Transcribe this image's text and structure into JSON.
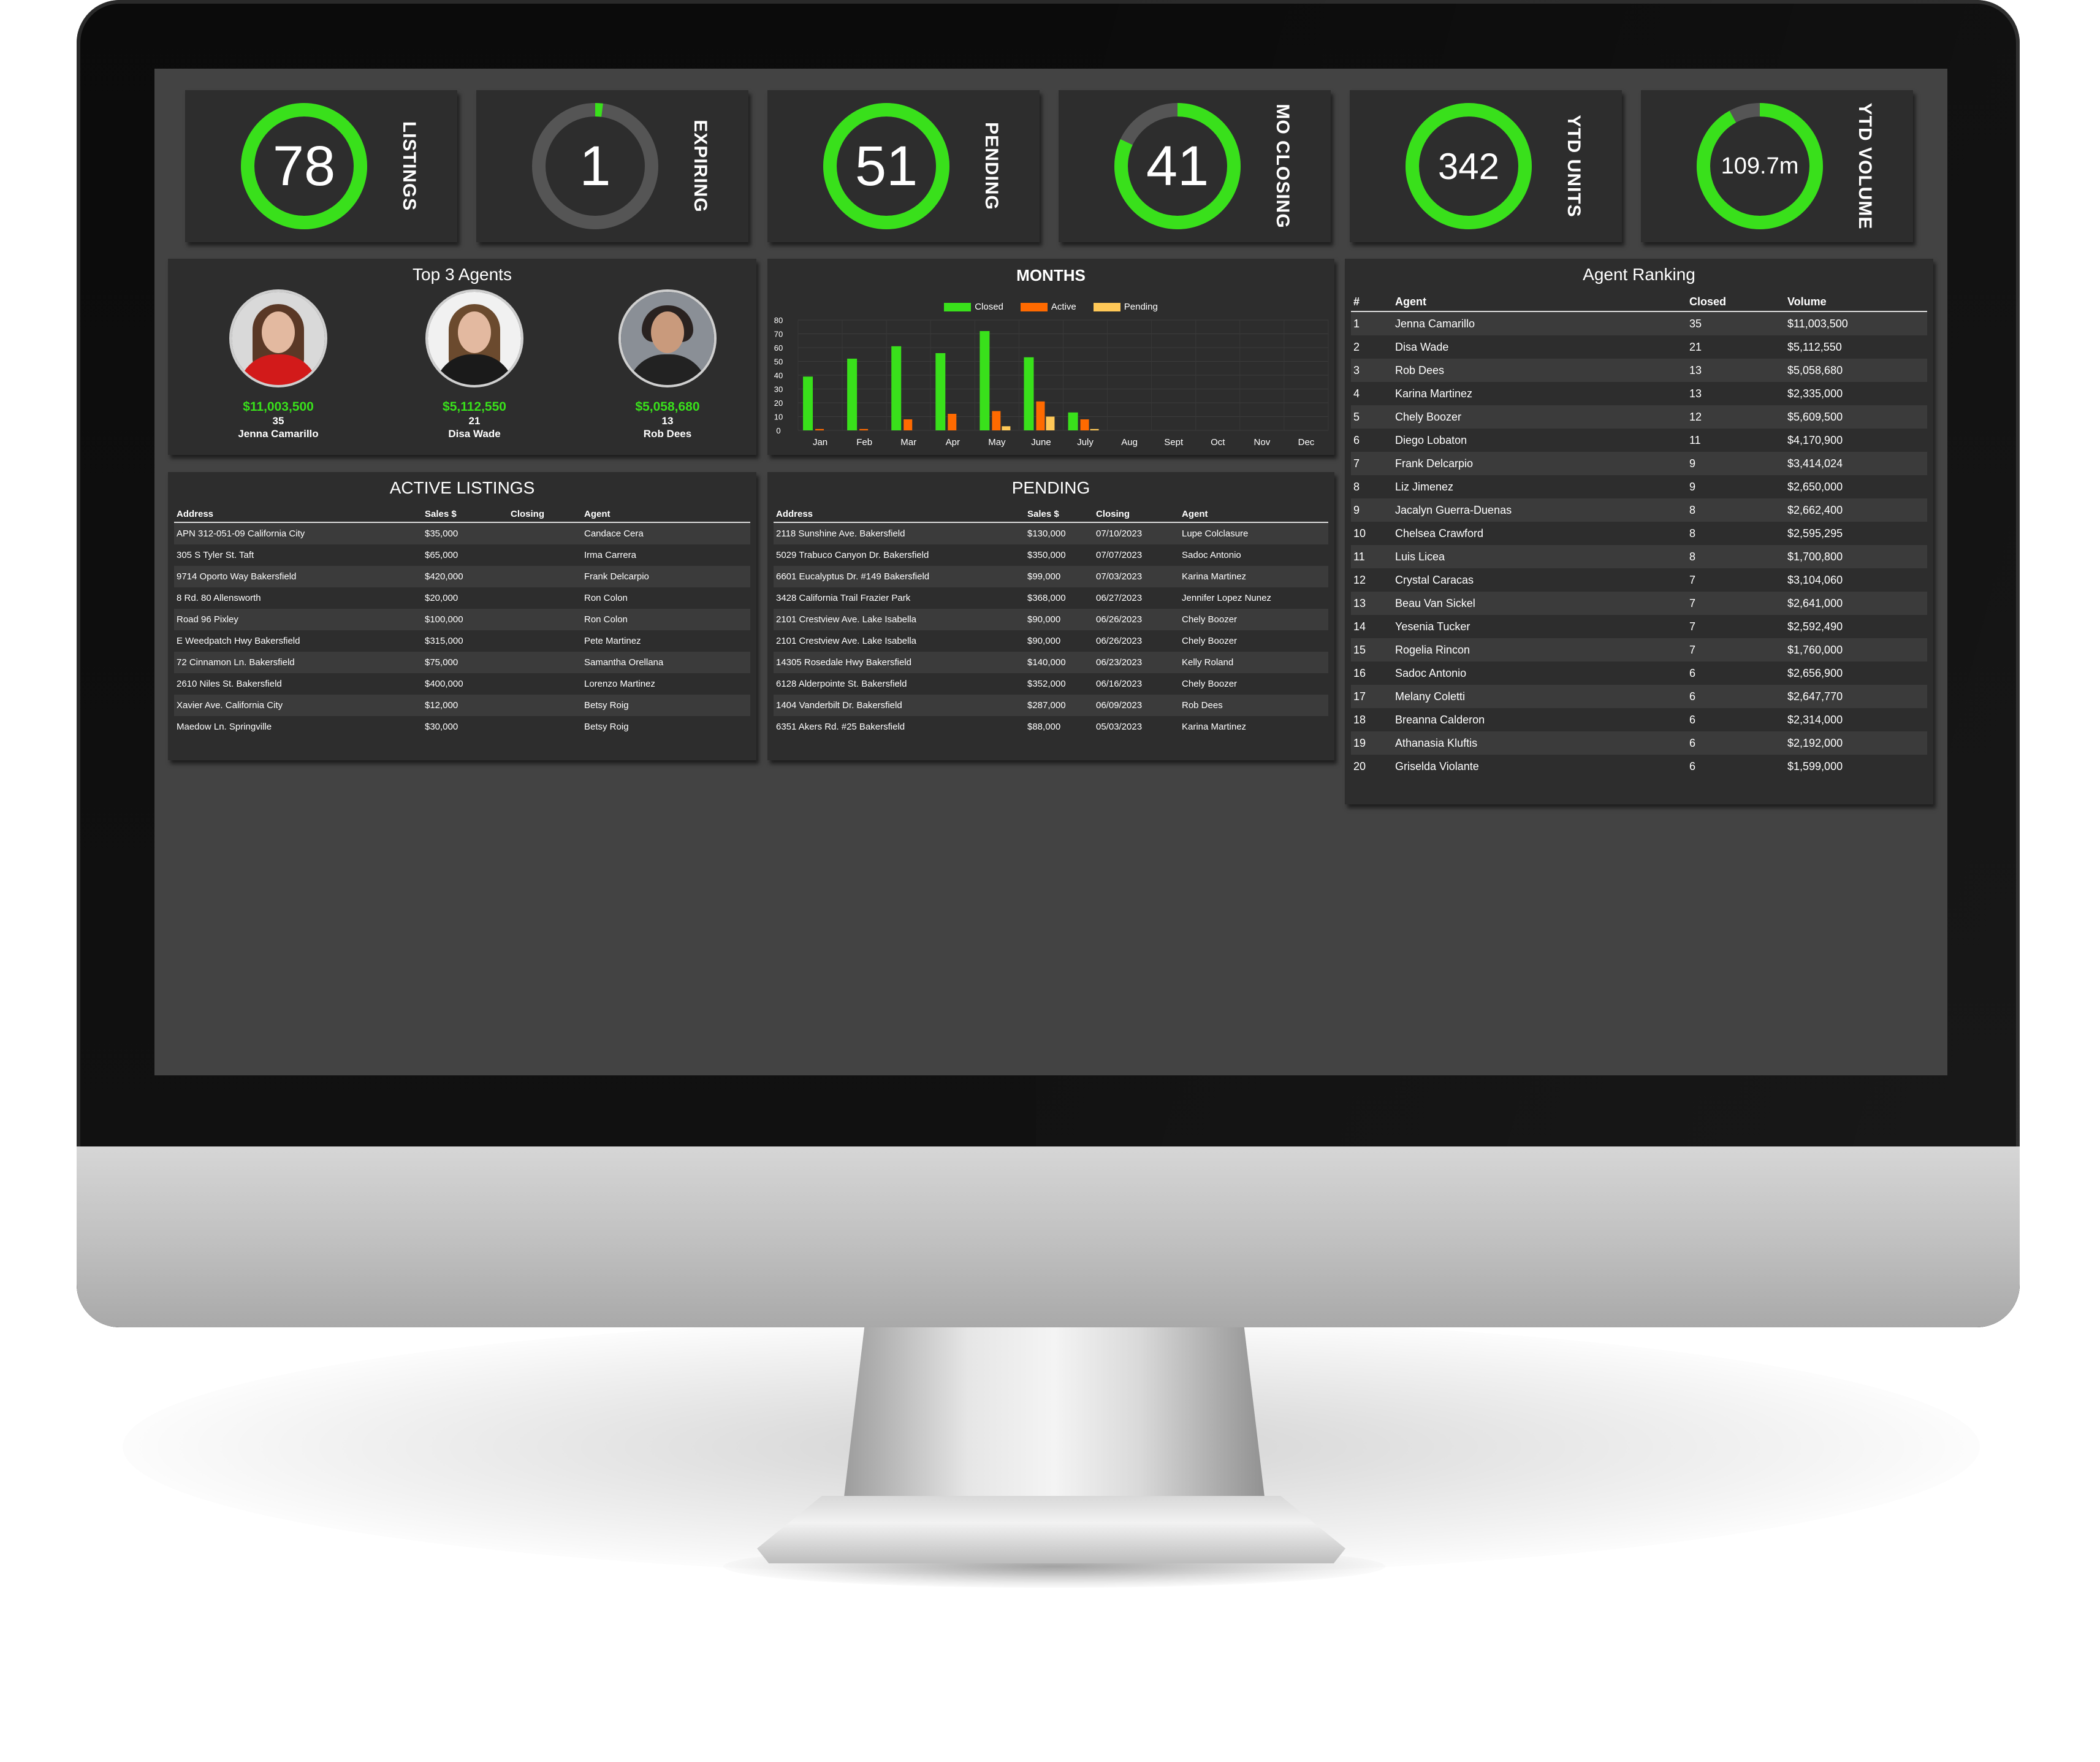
{
  "gauges": [
    {
      "value": "78",
      "label": "LISTINGS",
      "fill": 1.0
    },
    {
      "value": "1",
      "label": "EXPIRING",
      "fill": 0.02
    },
    {
      "value": "51",
      "label": "PENDING",
      "fill": 1.0
    },
    {
      "value": "41",
      "label": "MO CLOSING",
      "fill": 0.82
    },
    {
      "value": "342",
      "label": "YTD UNITS",
      "fill": 1.0
    },
    {
      "value": "109.7m",
      "label": "YTD VOLUME",
      "fill": 0.92
    }
  ],
  "colors": {
    "accent": "#39e01b",
    "track": "#555555",
    "orange": "#ff6a00",
    "yellow": "#ffc857"
  },
  "top_agents": {
    "title": "Top 3 Agents",
    "agents": [
      {
        "volume": "$11,003,500",
        "closed": "35",
        "name": "Jenna Camarillo"
      },
      {
        "volume": "$5,112,550",
        "closed": "21",
        "name": "Disa Wade"
      },
      {
        "volume": "$5,058,680",
        "closed": "13",
        "name": "Rob Dees"
      }
    ]
  },
  "chart_data": {
    "type": "bar",
    "title": "MONTHS",
    "categories": [
      "Jan",
      "Feb",
      "Mar",
      "Apr",
      "May",
      "June",
      "July",
      "Aug",
      "Sept",
      "Oct",
      "Nov",
      "Dec"
    ],
    "series": [
      {
        "name": "Closed",
        "color": "#39e01b",
        "values": [
          39,
          52,
          61,
          56,
          72,
          53,
          13,
          0,
          0,
          0,
          0,
          0
        ]
      },
      {
        "name": "Active",
        "color": "#ff6a00",
        "values": [
          1,
          1,
          8,
          12,
          14,
          21,
          8,
          0,
          0,
          0,
          0,
          0
        ]
      },
      {
        "name": "Pending",
        "color": "#ffc857",
        "values": [
          0,
          0,
          0,
          0,
          3,
          10,
          1,
          0,
          0,
          0,
          0,
          0
        ]
      }
    ],
    "ylim": [
      0,
      80
    ],
    "yticks": [
      "80",
      "70",
      "60",
      "50",
      "40",
      "30",
      "20",
      "10",
      "0"
    ],
    "grid": true,
    "legend": "top"
  },
  "active_listings": {
    "title": "ACTIVE LISTINGS",
    "columns": [
      "Address",
      "Sales $",
      "Closing",
      "Agent"
    ],
    "rows": [
      [
        "APN 312-051-09 California City",
        "$35,000",
        "",
        "Candace Cera"
      ],
      [
        "305 S Tyler St. Taft",
        "$65,000",
        "",
        "Irma Carrera"
      ],
      [
        "9714 Oporto Way Bakersfield",
        "$420,000",
        "",
        "Frank Delcarpio"
      ],
      [
        "8 Rd. 80 Allensworth",
        "$20,000",
        "",
        "Ron Colon"
      ],
      [
        "Road 96 Pixley",
        "$100,000",
        "",
        "Ron Colon"
      ],
      [
        "E Weedpatch Hwy Bakersfield",
        "$315,000",
        "",
        "Pete Martinez"
      ],
      [
        "72 Cinnamon Ln. Bakersfield",
        "$75,000",
        "",
        "Samantha Orellana"
      ],
      [
        "2610 Niles St. Bakersfield",
        "$400,000",
        "",
        "Lorenzo Martinez"
      ],
      [
        "Xavier Ave. California City",
        "$12,000",
        "",
        "Betsy Roig"
      ],
      [
        "Maedow Ln. Springville",
        "$30,000",
        "",
        "Betsy Roig"
      ]
    ]
  },
  "pending": {
    "title": "PENDING",
    "columns": [
      "Address",
      "Sales $",
      "Closing",
      "Agent"
    ],
    "rows": [
      [
        "2118 Sunshine Ave. Bakersfield",
        "$130,000",
        "07/10/2023",
        "Lupe Colclasure"
      ],
      [
        "5029 Trabuco Canyon Dr. Bakersfield",
        "$350,000",
        "07/07/2023",
        "Sadoc Antonio"
      ],
      [
        "6601 Eucalyptus Dr. #149 Bakersfield",
        "$99,000",
        "07/03/2023",
        "Karina Martinez"
      ],
      [
        "3428 California Trail Frazier Park",
        "$368,000",
        "06/27/2023",
        "Jennifer Lopez Nunez"
      ],
      [
        "2101 Crestview Ave. Lake Isabella",
        "$90,000",
        "06/26/2023",
        "Chely Boozer"
      ],
      [
        "2101 Crestview Ave. Lake Isabella",
        "$90,000",
        "06/26/2023",
        "Chely Boozer"
      ],
      [
        "14305 Rosedale Hwy Bakersfield",
        "$140,000",
        "06/23/2023",
        "Kelly Roland"
      ],
      [
        "6128 Alderpointe St. Bakersfield",
        "$352,000",
        "06/16/2023",
        "Chely Boozer"
      ],
      [
        "1404 Vanderbilt Dr. Bakersfield",
        "$287,000",
        "06/09/2023",
        "Rob Dees"
      ],
      [
        "6351 Akers Rd. #25 Bakersfield",
        "$88,000",
        "05/03/2023",
        "Karina Martinez"
      ]
    ]
  },
  "agent_ranking": {
    "title": "Agent Ranking",
    "columns": [
      "#",
      "Agent",
      "Closed",
      "Volume"
    ],
    "rows": [
      [
        "1",
        "Jenna Camarillo",
        "35",
        "$11,003,500"
      ],
      [
        "2",
        "Disa Wade",
        "21",
        "$5,112,550"
      ],
      [
        "3",
        "Rob Dees",
        "13",
        "$5,058,680"
      ],
      [
        "4",
        "Karina Martinez",
        "13",
        "$2,335,000"
      ],
      [
        "5",
        "Chely Boozer",
        "12",
        "$5,609,500"
      ],
      [
        "6",
        "Diego Lobaton",
        "11",
        "$4,170,900"
      ],
      [
        "7",
        "Frank Delcarpio",
        "9",
        "$3,414,024"
      ],
      [
        "8",
        "Liz Jimenez",
        "9",
        "$2,650,000"
      ],
      [
        "9",
        "Jacalyn Guerra-Duenas",
        "8",
        "$2,662,400"
      ],
      [
        "10",
        "Chelsea Crawford",
        "8",
        "$2,595,295"
      ],
      [
        "11",
        "Luis Licea",
        "8",
        "$1,700,800"
      ],
      [
        "12",
        "Crystal Caracas",
        "7",
        "$3,104,060"
      ],
      [
        "13",
        "Beau Van Sickel",
        "7",
        "$2,641,000"
      ],
      [
        "14",
        "Yesenia Tucker",
        "7",
        "$2,592,490"
      ],
      [
        "15",
        "Rogelia Rincon",
        "7",
        "$1,760,000"
      ],
      [
        "16",
        "Sadoc Antonio",
        "6",
        "$2,656,900"
      ],
      [
        "17",
        "Melany Coletti",
        "6",
        "$2,647,770"
      ],
      [
        "18",
        "Breanna Calderon",
        "6",
        "$2,314,000"
      ],
      [
        "19",
        "Athanasia Kluftis",
        "6",
        "$2,192,000"
      ],
      [
        "20",
        "Griselda Violante",
        "6",
        "$1,599,000"
      ]
    ]
  }
}
